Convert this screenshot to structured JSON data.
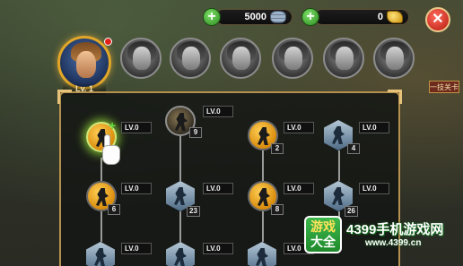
{
  "currency": {
    "silver": "5000",
    "gold": "0"
  },
  "heroes": {
    "active_level": "Lv. 1",
    "side_tag": "一技关卡"
  },
  "skills": {
    "lv": "LV.0",
    "counts": [
      "9",
      "2",
      "4",
      "6",
      "23",
      "8",
      "26"
    ]
  },
  "watermark": {
    "logo_top": "游戏",
    "logo_bottom": "大全",
    "text": "4399手机游戏网",
    "url": "www.4399.cn"
  },
  "colors": {
    "accent_gold": "#e2a728",
    "panel_border": "#b5904e",
    "close_red": "#b51a10",
    "plus_green": "#2a8a1e"
  }
}
